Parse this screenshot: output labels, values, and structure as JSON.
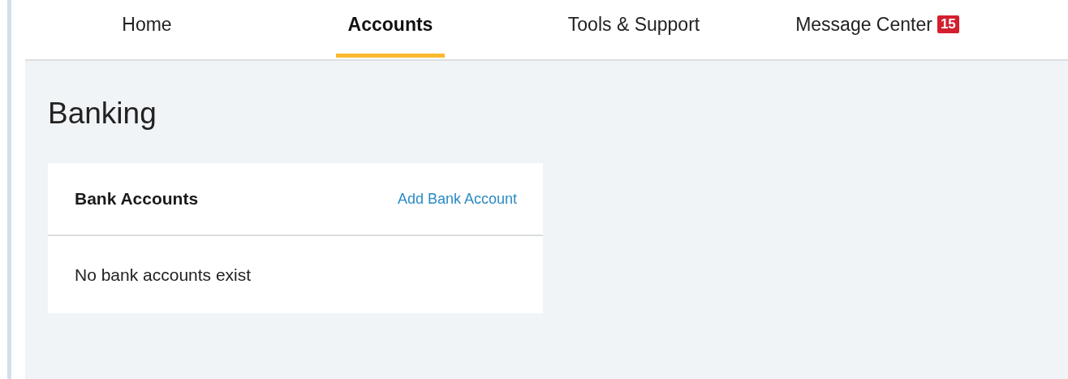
{
  "nav": {
    "tabs": [
      {
        "label": "Home",
        "selected": false
      },
      {
        "label": "Accounts",
        "selected": true
      },
      {
        "label": "Tools & Support",
        "selected": false
      },
      {
        "label": "Message Center",
        "selected": false,
        "badge": "15"
      }
    ]
  },
  "page": {
    "title": "Banking"
  },
  "card": {
    "title": "Bank Accounts",
    "action": "Add Bank Account",
    "empty_message": "No bank accounts exist"
  }
}
